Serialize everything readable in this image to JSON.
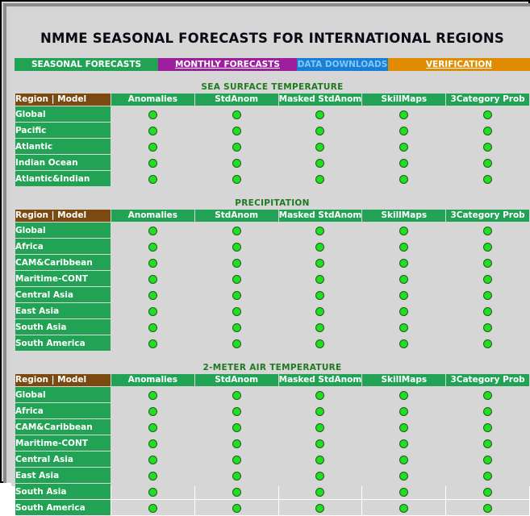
{
  "page": {
    "title": "NMME SEASONAL FORECASTS FOR INTERNATIONAL REGIONS"
  },
  "nav": {
    "tabs": [
      {
        "label": "SEASONAL FORECASTS",
        "color": "#22a255",
        "text_color": "#ffffff",
        "active": true
      },
      {
        "label": "MONTHLY FORECASTS",
        "color": "#9e1f9e",
        "text_color": "#ffffff",
        "active": false
      },
      {
        "label": "DATA DOWNLOADS",
        "color": "#1a7fd4",
        "text_color": "#7ec8fb",
        "active": false
      },
      {
        "label": "VERIFICATION",
        "color": "#e08b00",
        "text_color": "#ffffff",
        "active": false
      }
    ]
  },
  "columns": {
    "region_header": "Region | Model",
    "data_headers": [
      "Anomalies",
      "StdAnom",
      "Masked StdAnom",
      "SkillMaps",
      "3Category Prob"
    ]
  },
  "sections": [
    {
      "title": "SEA SURFACE TEMPERATURE",
      "rows": [
        {
          "region": "Global",
          "cells": [
            "dot",
            "dot",
            "dot",
            "dot",
            "dot"
          ]
        },
        {
          "region": "Pacific",
          "cells": [
            "dot",
            "dot",
            "dot",
            "dot",
            "dot"
          ]
        },
        {
          "region": "Atlantic",
          "cells": [
            "dot",
            "dot",
            "dot",
            "dot",
            "dot"
          ]
        },
        {
          "region": "Indian Ocean",
          "cells": [
            "dot",
            "dot",
            "dot",
            "dot",
            "dot"
          ]
        },
        {
          "region": "Atlantic&Indian",
          "cells": [
            "dot",
            "dot",
            "dot",
            "dot",
            "dot"
          ]
        }
      ]
    },
    {
      "title": "PRECIPITATION",
      "rows": [
        {
          "region": "Global",
          "cells": [
            "dot",
            "dot",
            "dot",
            "dot",
            "dot"
          ]
        },
        {
          "region": "Africa",
          "cells": [
            "dot",
            "dot",
            "dot",
            "dot",
            "dot"
          ]
        },
        {
          "region": "CAM&Caribbean",
          "cells": [
            "dot",
            "dot",
            "dot",
            "dot",
            "dot"
          ]
        },
        {
          "region": "Maritime-CONT",
          "cells": [
            "dot",
            "dot",
            "dot",
            "dot",
            "dot"
          ]
        },
        {
          "region": "Central Asia",
          "cells": [
            "dot",
            "dot",
            "dot",
            "dot",
            "dot"
          ]
        },
        {
          "region": "East Asia",
          "cells": [
            "dot",
            "dot",
            "dot",
            "dot",
            "dot"
          ]
        },
        {
          "region": "South Asia",
          "cells": [
            "dot",
            "dot",
            "dot",
            "dot",
            "dot"
          ]
        },
        {
          "region": "South America",
          "cells": [
            "dot",
            "dot",
            "dot",
            "dot",
            "dot"
          ]
        }
      ]
    },
    {
      "title": "2-METER AIR TEMPERATURE",
      "rows": [
        {
          "region": "Global",
          "cells": [
            "dot",
            "dot",
            "dot",
            "dot",
            "dot"
          ]
        },
        {
          "region": "Africa",
          "cells": [
            "dot",
            "dot",
            "dot",
            "dot",
            "dot"
          ]
        },
        {
          "region": "CAM&Caribbean",
          "cells": [
            "dot",
            "dot",
            "dot",
            "dot",
            "dot"
          ]
        },
        {
          "region": "Maritime-CONT",
          "cells": [
            "dot",
            "dot",
            "dot",
            "dot",
            "dot"
          ]
        },
        {
          "region": "Central Asia",
          "cells": [
            "dot",
            "dot",
            "dot",
            "dot",
            "dot"
          ]
        },
        {
          "region": "East Asia",
          "cells": [
            "dot",
            "dot",
            "dot",
            "dot",
            "dot"
          ]
        },
        {
          "region": "South Asia",
          "cells": [
            "dot",
            "dot",
            "dot",
            "dot",
            "dot"
          ]
        },
        {
          "region": "South America",
          "cells": [
            "dot",
            "dot",
            "dot",
            "dot",
            "dot"
          ]
        }
      ]
    }
  ],
  "icons": {
    "available_dot": "green-dot-icon"
  }
}
